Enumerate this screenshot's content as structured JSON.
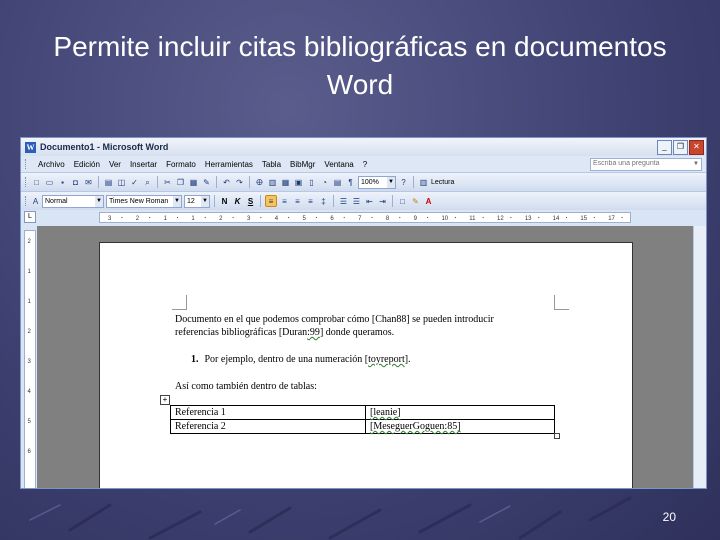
{
  "slide": {
    "title": "Permite incluir citas bibliográficas en documentos Word",
    "page_number": "20"
  },
  "window": {
    "title": "Documento1 - Microsoft Word",
    "minimize": "_",
    "restore": "❐",
    "close": "✕"
  },
  "menu": {
    "items": [
      "Archivo",
      "Edición",
      "Ver",
      "Insertar",
      "Formato",
      "Herramientas",
      "Tabla",
      "BibMgr",
      "Ventana",
      "?"
    ],
    "help_placeholder": "Escriba una pregunta"
  },
  "toolbar": {
    "zoom": "100%",
    "reading_label": "Lectura",
    "style": "Normal",
    "font": "Times New Roman",
    "size": "12"
  },
  "ruler": {
    "labels": [
      "3",
      "2",
      "1",
      "1",
      "2",
      "3",
      "4",
      "5",
      "6",
      "7",
      "8",
      "9",
      "10",
      "11",
      "12",
      "13",
      "14",
      "15",
      "17"
    ],
    "vertical_labels": [
      "2",
      "1",
      "1",
      "2",
      "3",
      "4",
      "5",
      "6"
    ]
  },
  "document": {
    "paragraph1_line1": "Documento en el que podemos comprobar cómo [Chan88] se pueden introducir",
    "paragraph1_line2_a": "referencias bibliográficas [Duran",
    "paragraph1_line2_b": ":99",
    "paragraph1_line2_c": "] donde queramos.",
    "list_number": "1.",
    "list_text_a": "Por ejemplo, dentro de una numeración [",
    "list_text_b": "toyreport",
    "list_text_c": "].",
    "paragraph2": "Así como también dentro de tablas:",
    "table": [
      [
        "Referencia 1",
        "[leanie]"
      ],
      [
        "Referencia 2",
        "[MeseguerGoguen:85]"
      ]
    ]
  },
  "colors": {
    "slide_background": "#3f4272",
    "window_chrome": "#d9e4f4",
    "close_button": "#c8452e",
    "doc_background": "#808080"
  }
}
